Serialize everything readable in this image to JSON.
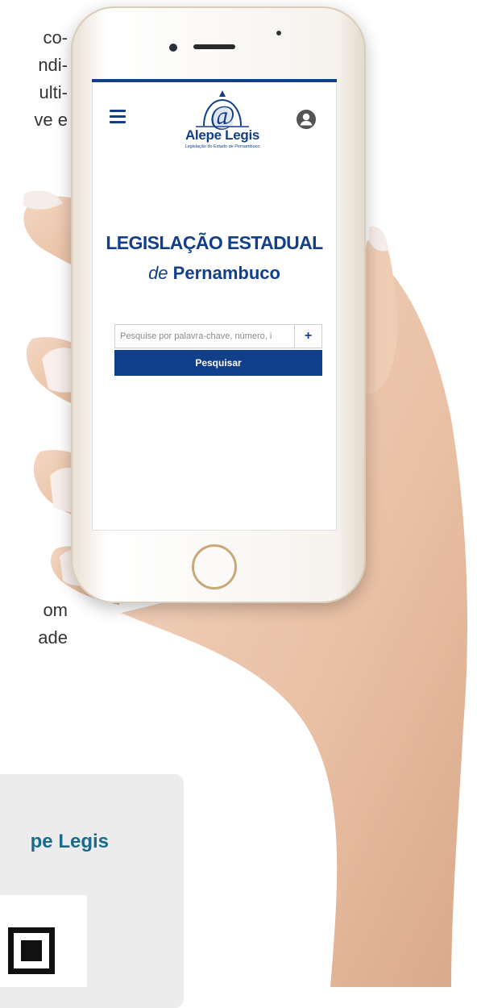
{
  "background": {
    "fragment_top_lines": [
      "co-",
      "ndi-",
      "ulti-",
      "ve e"
    ],
    "fragment_mid_lines": [
      "om",
      "ade"
    ],
    "card_title": "pe Legis"
  },
  "app": {
    "logo_name": "Alepe Legis",
    "logo_subtitle": "Legislação do Estado de Pernambuco",
    "headline": "LEGISLAÇÃO ESTADUAL",
    "subline_de": "de",
    "subline_state": "Pernambuco",
    "search": {
      "placeholder": "Pesquise por palavra-chave, número, i",
      "value": "",
      "plus_label": "+",
      "button_label": "Pesquisar"
    }
  },
  "icons": [
    "menu-icon",
    "user-icon",
    "logo-icon",
    "plus-icon",
    "qr-code-icon"
  ],
  "colors": {
    "brand_blue": "#123f8a",
    "card_title": "#1a6b8a",
    "card_bg": "#ececec"
  }
}
